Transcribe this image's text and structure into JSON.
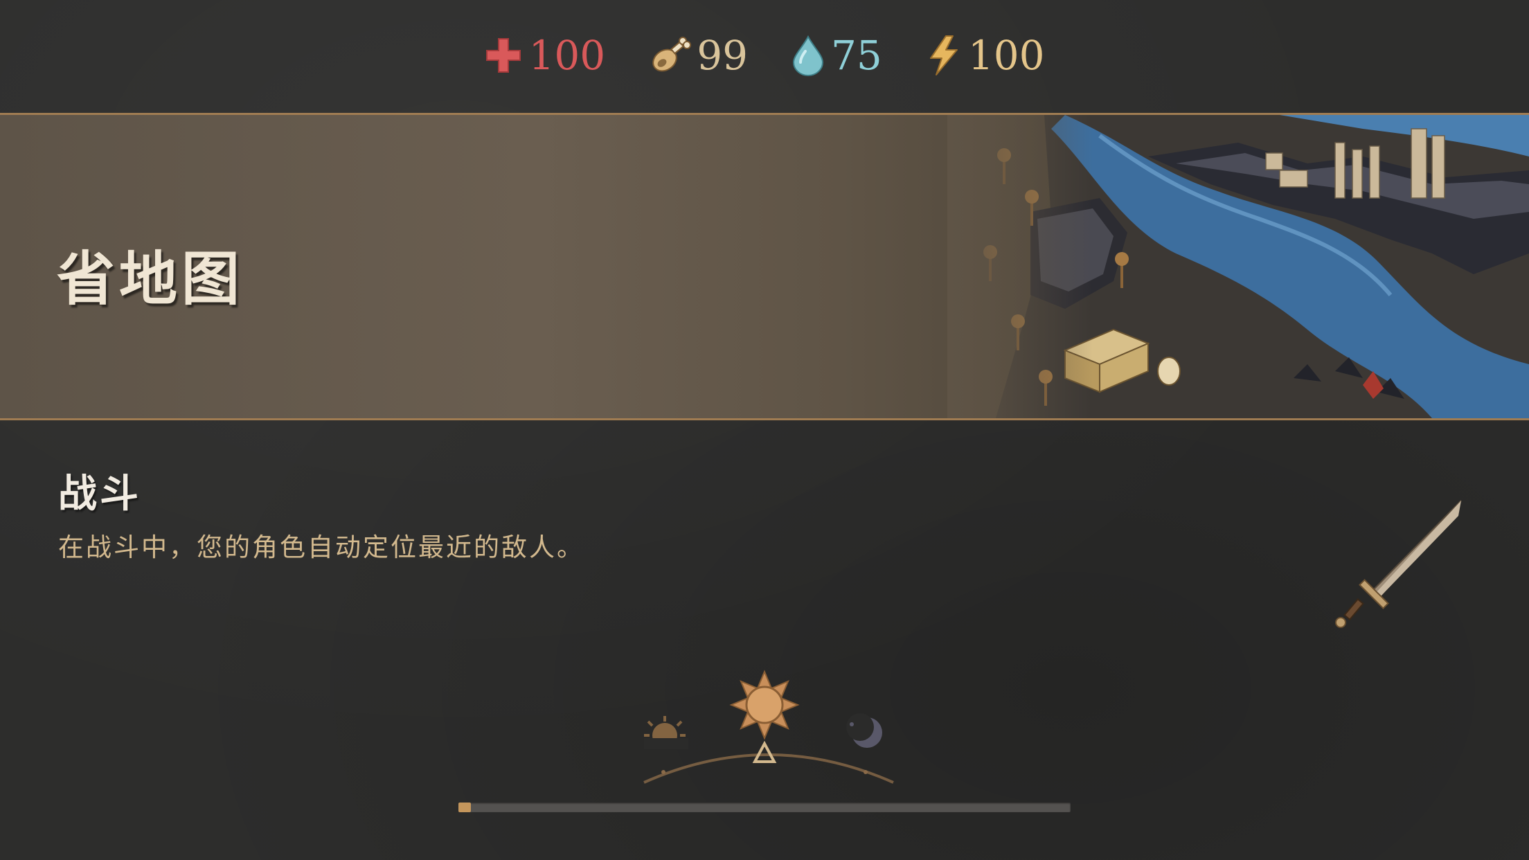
{
  "stats": {
    "health": {
      "value": "100",
      "icon": "health-cross-icon",
      "color": "#d9595a"
    },
    "food": {
      "value": "99",
      "icon": "meat-drumstick-icon",
      "color": "#d9c49b"
    },
    "water": {
      "value": "75",
      "icon": "water-drop-icon",
      "color": "#8fd0d8"
    },
    "energy": {
      "value": "100",
      "icon": "lightning-bolt-icon",
      "color": "#e4c58a"
    }
  },
  "banner": {
    "title": "省地图",
    "art": "province-map-illustration"
  },
  "tip": {
    "title": "战斗",
    "description": "在战斗中，您的角色自动定位最近的敌人。",
    "icon": "sword-icon"
  },
  "day_cycle": {
    "phases": [
      "sunrise-icon",
      "sun-icon",
      "moon-icon"
    ],
    "current_phase": "sun-icon"
  },
  "loading": {
    "progress_percent": 2,
    "fill_color": "#c4965c"
  }
}
